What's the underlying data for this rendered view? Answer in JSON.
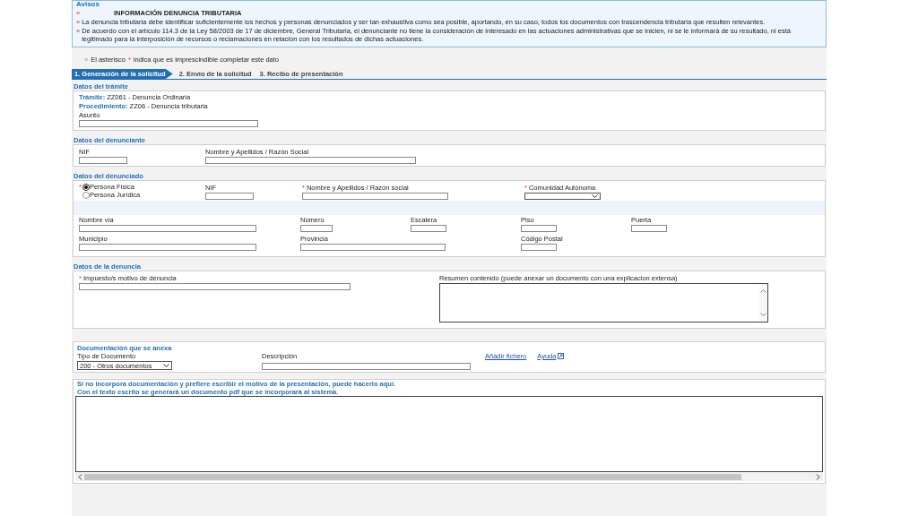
{
  "notice": {
    "title": "Avisos",
    "bullet": "»",
    "heading": "INFORMACIÓN DENUNCIA TRIBUTARIA",
    "items": [
      "La denuncia tributaria debe identificar suficientemente los hechos y personas denunciados y ser tan exhaustiva como sea posible, aportando, en su caso, todos los documentos con trascendencia tributaria que resulten relevantes.",
      "De acuerdo con el artículo 114.3 de la Ley 58/2003 de 17 de diciembre, General Tributaria, el denunciante no tiene la consideración de interesado en las actuaciones administrativas que se inicien, ni se le informará de su resultado, ni está legitimado para la interposición de recursos o reclamaciones en relación con los resultados de dichas actuaciones."
    ]
  },
  "required_note": {
    "bullet": "»",
    "before": "El asterisco",
    "mark": "*",
    "after": "indica que es imprescindible completar este dato"
  },
  "steps": [
    {
      "label": "1. Generación de la solicitud",
      "selected": true
    },
    {
      "label": "2. Envío de la solicitud",
      "selected": false
    },
    {
      "label": "3. Recibo de presentación",
      "selected": false
    }
  ],
  "tramite": {
    "title": "Datos del trámite",
    "lines": [
      {
        "key": "Trámite:",
        "value": "ZZ061 - Denuncia Ordinaria"
      },
      {
        "key": "Procedimiento:",
        "value": "ZZ06 - Denuncia tributaria"
      }
    ],
    "subject_label": "Asunto"
  },
  "denunciante": {
    "title": "Datos del denunciante",
    "fields": [
      {
        "label": "NIF",
        "required": false
      },
      {
        "label": "Nombre y Apellidos / Razón Social",
        "required": false
      }
    ]
  },
  "denunciado": {
    "title": "Datos del denunciado",
    "person_type": {
      "required": true,
      "options": [
        {
          "label": "Persona Física",
          "selected": true
        },
        {
          "label": "Persona Jurídica",
          "selected": false
        }
      ]
    },
    "fields": [
      {
        "label": "NIF",
        "required": false
      },
      {
        "label": "Nombre y Apellidos / Razón social",
        "required": true
      },
      {
        "label": "Comunidad Autónoma",
        "required": true,
        "kind": "select"
      }
    ],
    "address": [
      {
        "label": "Nombre vía",
        "required": false
      },
      {
        "label": "Número",
        "required": false
      },
      {
        "label": "Escalera",
        "required": false
      },
      {
        "label": "Piso",
        "required": false
      },
      {
        "label": "Puerta",
        "required": false
      }
    ],
    "address2": [
      {
        "label": "Municipio",
        "required": false
      },
      {
        "label": "Provincia",
        "required": false
      },
      {
        "label": "Código Postal",
        "required": false
      }
    ]
  },
  "denuncia": {
    "title": "Datos de la denuncia",
    "tax_label": "Impuesto/s motivo de denuncia",
    "tax_required": true,
    "summary_label": "Resumen contenido (puede anexar un documento con una explicacion extensa)"
  },
  "documentacion": {
    "title": "Documentación que se anexa",
    "type_label": "Tipo de Documento",
    "type_value": "200 - Otros documentos",
    "description_label": "Descripción",
    "links": [
      "Añadir fichero",
      "Ayuda"
    ]
  },
  "free_text": {
    "lines": [
      "Si no incorpora documentación y prefiere escribir el motivo de la presentación, puede hacerlo aquí.",
      "Con el texto escrito se generará un documento pdf que se incorporará al sistema."
    ]
  }
}
